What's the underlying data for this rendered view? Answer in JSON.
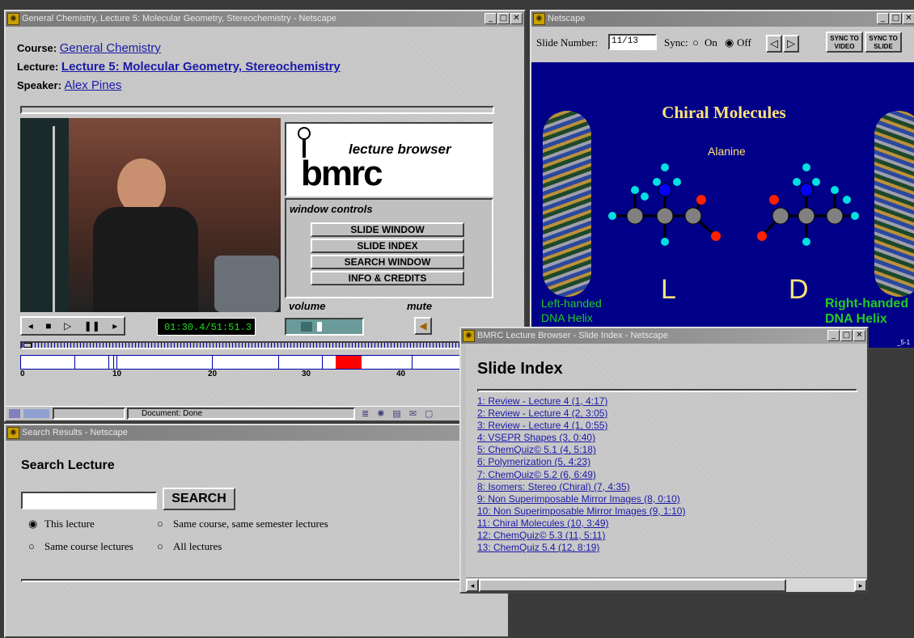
{
  "lecture_window": {
    "title": "General Chemistry, Lecture 5: Molecular Geometry, Stereochemistry - Netscape",
    "course_label": "Course:",
    "course_value": "General Chemistry",
    "lecture_label": "Lecture:",
    "lecture_value": "Lecture 5: Molecular Geometry, Stereochemistry",
    "speaker_label": "Speaker:",
    "speaker_value": "Alex Pines",
    "brand_title": "lecture browser",
    "brand_logo": "bmrc",
    "window_controls_label": "window controls",
    "buttons": [
      "SLIDE WINDOW",
      "SLIDE INDEX",
      "SEARCH WINDOW",
      "INFO & CREDITS"
    ],
    "volume_label": "volume",
    "mute_label": "mute",
    "time_readout": "01:30.4/51:51.3",
    "timeline_ticks": [
      "0",
      "10",
      "20",
      "30",
      "40"
    ],
    "status": "Document: Done"
  },
  "slide_window": {
    "title": "Netscape",
    "slide_number_label": "Slide Number:",
    "slide_number_value": "11/13",
    "sync_label": "Sync:",
    "sync_on": "On",
    "sync_off": "Off",
    "sync_to_video": "SYNC TO VIDEO",
    "sync_to_slide": "SYNC TO SLIDE",
    "slide_title": "Chiral Molecules",
    "molecule": "Alanine",
    "left_letter": "L",
    "right_letter": "D",
    "left_caption_1": "Left-handed",
    "left_caption_2": "DNA Helix",
    "right_caption_1": "Right-handed",
    "right_caption_2": "DNA Helix",
    "slide_code": "_5-1"
  },
  "index_window": {
    "title": "BMRC Lecture Browser - Slide Index - Netscape",
    "heading": "Slide Index",
    "items": [
      "1: Review - Lecture 4 (1, 4:17)",
      "2: Review - Lecture 4 (2, 3:05)",
      "3: Review - Lecture 4 (1, 0:55)",
      "4: VSEPR Shapes (3, 0:40)",
      "5: ChemQuiz© 5.1 (4, 5:18)",
      "6: Polymerization (5, 4:23)",
      "7: ChemQuiz© 5.2 (6, 6:49)",
      "8: Isomers: Stereo (Chiral) (7, 4:35)",
      "9: Non Superimposable Mirror Images (8, 0:10)",
      "10: Non Superimposable Mirror Images (9, 1:10)",
      "11: Chiral Molecules (10, 3:49)",
      "12: ChemQuiz© 5.3 (11, 5:11)",
      "13: ChemQuiz 5.4 (12, 8:19)"
    ]
  },
  "search_window": {
    "title": "Search Results - Netscape",
    "heading": "Search Lecture",
    "input_value": "",
    "search_button": "SEARCH",
    "options": [
      "This lecture",
      "Same course, same semester lectures",
      "Same course lectures",
      "All lectures"
    ],
    "selected_option": "This lecture"
  },
  "colors": {
    "slide_bg": "#000088",
    "slide_title": "#ffe37a",
    "caption_green": "#22cc22",
    "timeline_highlight": "#ff0000"
  }
}
